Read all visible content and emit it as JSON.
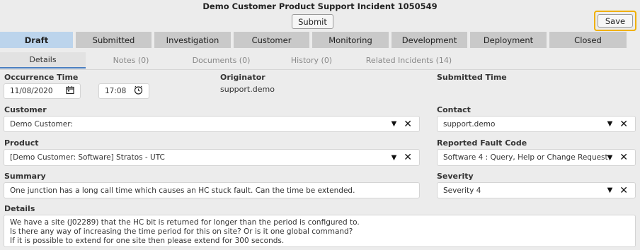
{
  "header": {
    "title": "Demo Customer Product Support Incident 1050549",
    "submit_label": "Submit",
    "save_label": "Save"
  },
  "stages": [
    "Draft",
    "Submitted",
    "Investigation",
    "Customer",
    "Monitoring",
    "Development",
    "Deployment",
    "Closed"
  ],
  "subtabs": [
    "Details",
    "Notes (0)",
    "Documents (0)",
    "History (0)",
    "Related Incidents (14)"
  ],
  "form": {
    "occurrence_time_label": "Occurrence Time",
    "occurrence_date": "11/08/2020",
    "occurrence_clock": "17:08",
    "originator_label": "Originator",
    "originator_value": "support.demo",
    "submitted_time_label": "Submitted Time",
    "customer_label": "Customer",
    "customer_value": "Demo Customer:",
    "contact_label": "Contact",
    "contact_value": "support.demo",
    "product_label": "Product",
    "product_value": "[Demo Customer: Software] Stratos - UTC",
    "fault_code_label": "Reported Fault Code",
    "fault_code_value": "Software 4 : Query, Help or Change Request",
    "summary_label": "Summary",
    "summary_value": "One junction has a long call time which causes an HC stuck fault. Can the time be extended.",
    "severity_label": "Severity",
    "severity_value": "Severity 4",
    "details_label": "Details",
    "details_lines": [
      "We have a site (J02289) that the HC bit is returned for longer than the period is configured to.",
      "Is there any way of increasing the time period for this on site? Or is it one global command?",
      "If it is possible to extend for one site then please extend for 300 seconds."
    ]
  },
  "icons": {
    "calendar": "calendar-icon",
    "clock": "clock-icon",
    "dropdown": "caret-down-icon",
    "clear": "close-icon"
  },
  "colors": {
    "active_stage": "#bcd4ec",
    "stage": "#c9c9c9",
    "save_highlight": "#f0b000",
    "tab_underline": "#4a7fc0"
  }
}
